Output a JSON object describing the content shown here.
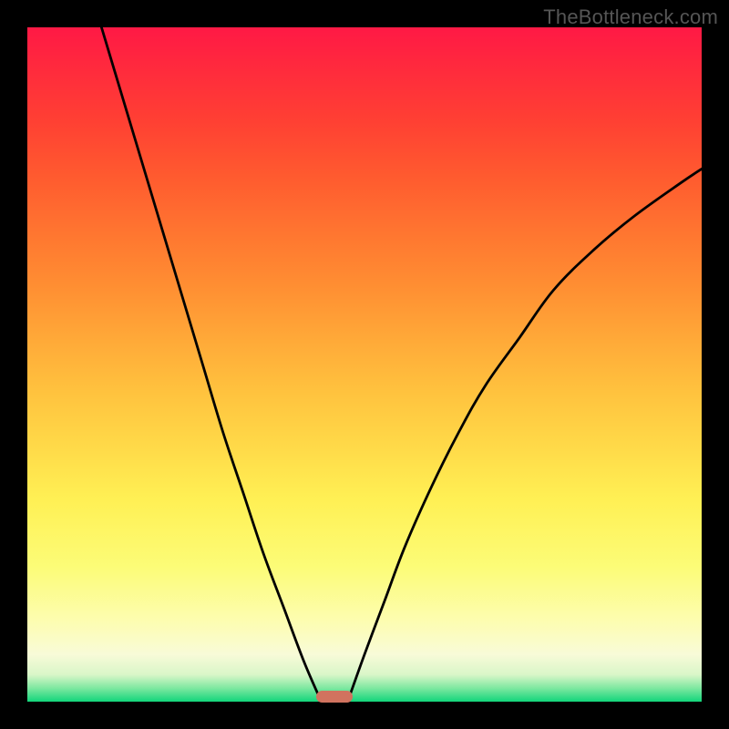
{
  "watermark": "TheBottleneck.com",
  "chart_data": {
    "type": "line",
    "title": "",
    "xlabel": "",
    "ylabel": "",
    "xlim": [
      0,
      100
    ],
    "ylim": [
      0,
      100
    ],
    "gradient_stops": [
      {
        "pct": 0,
        "color": "#ff1945"
      },
      {
        "pct": 50,
        "color": "#ffc23e"
      },
      {
        "pct": 90,
        "color": "#fcfcc0"
      },
      {
        "pct": 100,
        "color": "#12d57b"
      }
    ],
    "marker": {
      "x_center": 45.5,
      "width": 5.4
    },
    "series": [
      {
        "name": "left-branch",
        "x": [
          11,
          14,
          17,
          20,
          23,
          26,
          29,
          32,
          35,
          38,
          41,
          43.6
        ],
        "y": [
          100,
          90,
          80,
          70,
          60,
          50,
          40,
          31,
          22,
          14,
          6,
          0
        ]
      },
      {
        "name": "right-branch",
        "x": [
          47.5,
          50,
          53,
          56,
          60,
          64,
          68,
          73,
          78,
          84,
          90,
          97,
          100
        ],
        "y": [
          0,
          7,
          15,
          23,
          32,
          40,
          47,
          54,
          61,
          67,
          72,
          77,
          79
        ]
      }
    ]
  }
}
